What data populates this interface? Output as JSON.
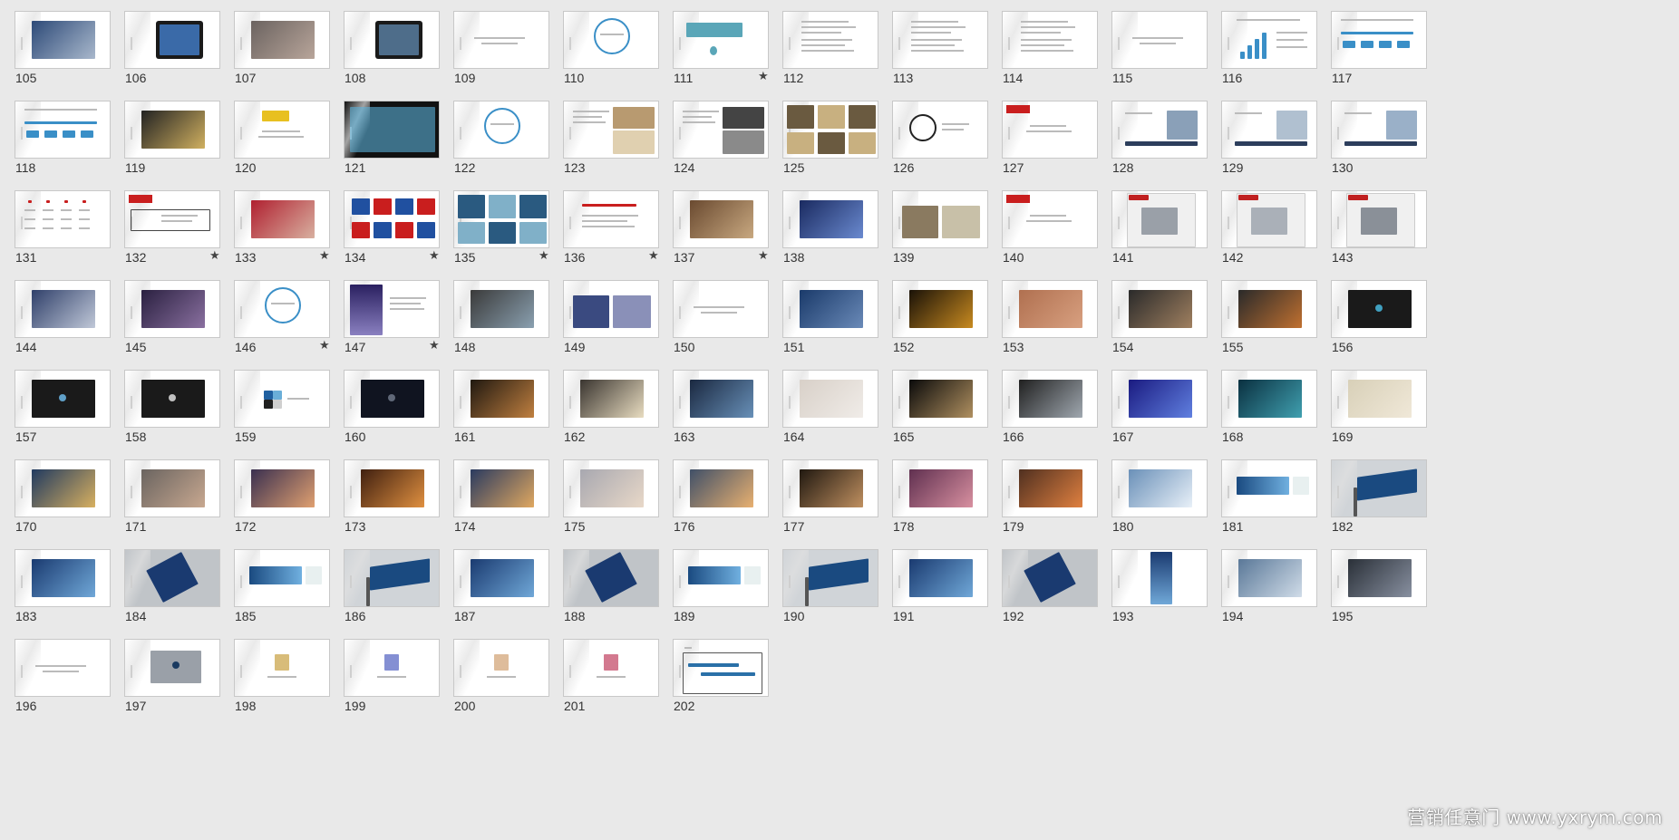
{
  "slides": [
    {
      "num": "105",
      "star": false,
      "v": "photo",
      "c": [
        "#2d4a78",
        "#a9b8cc"
      ]
    },
    {
      "num": "106",
      "star": false,
      "v": "tablet",
      "c": [
        "#1a1a1a",
        "#3a6aa8"
      ]
    },
    {
      "num": "107",
      "star": false,
      "v": "photo",
      "c": [
        "#6b6360",
        "#b8a59a"
      ]
    },
    {
      "num": "108",
      "star": false,
      "v": "tablet",
      "c": [
        "#1a1a1a",
        "#4e6d8a"
      ]
    },
    {
      "num": "109",
      "star": false,
      "v": "text",
      "c": [
        "#888888",
        "#ffffff"
      ]
    },
    {
      "num": "110",
      "star": false,
      "v": "circle",
      "c": [
        "#3a8fc7",
        "#ffffff"
      ]
    },
    {
      "num": "111",
      "star": true,
      "v": "banner",
      "c": [
        "#5aa6b8",
        "#ffffff"
      ]
    },
    {
      "num": "112",
      "star": false,
      "v": "doc",
      "c": [
        "#999999",
        "#ffffff"
      ]
    },
    {
      "num": "113",
      "star": false,
      "v": "doc",
      "c": [
        "#aaaaaa",
        "#ffffff"
      ]
    },
    {
      "num": "114",
      "star": false,
      "v": "doc",
      "c": [
        "#999999",
        "#ffffff"
      ]
    },
    {
      "num": "115",
      "star": false,
      "v": "text",
      "c": [
        "#aaaaaa",
        "#ffffff"
      ]
    },
    {
      "num": "116",
      "star": false,
      "v": "chart",
      "c": [
        "#3a8fc7",
        "#ffffff"
      ]
    },
    {
      "num": "117",
      "star": false,
      "v": "diagram",
      "c": [
        "#3a8fc7",
        "#ffffff"
      ]
    },
    {
      "num": "118",
      "star": false,
      "v": "diagram",
      "c": [
        "#3a8fc7",
        "#ffffff"
      ]
    },
    {
      "num": "119",
      "star": false,
      "v": "photo",
      "c": [
        "#222222",
        "#d0b060"
      ]
    },
    {
      "num": "120",
      "star": false,
      "v": "logo",
      "c": [
        "#e8c020",
        "#ffffff"
      ]
    },
    {
      "num": "121",
      "star": false,
      "v": "full",
      "c": [
        "#111111",
        "#5bb0d8"
      ]
    },
    {
      "num": "122",
      "star": false,
      "v": "circle",
      "c": [
        "#3a8fc7",
        "#ffffff"
      ]
    },
    {
      "num": "123",
      "star": false,
      "v": "photo-r",
      "c": [
        "#b89a70",
        "#e0d0b0"
      ]
    },
    {
      "num": "124",
      "star": false,
      "v": "photo-r",
      "c": [
        "#444444",
        "#8a8a8a"
      ]
    },
    {
      "num": "125",
      "star": false,
      "v": "collage",
      "c": [
        "#6a5a40",
        "#c8b080"
      ]
    },
    {
      "num": "126",
      "star": false,
      "v": "circle-b",
      "c": [
        "#222222",
        "#ffffff"
      ]
    },
    {
      "num": "127",
      "star": false,
      "v": "redtag",
      "c": [
        "#c91e1e",
        "#ffffff"
      ]
    },
    {
      "num": "128",
      "star": false,
      "v": "dark-bar",
      "c": [
        "#2c3e5c",
        "#8aa0b8"
      ]
    },
    {
      "num": "129",
      "star": false,
      "v": "dark-bar",
      "c": [
        "#2c3e5c",
        "#b0c0d0"
      ]
    },
    {
      "num": "130",
      "star": false,
      "v": "dark-bar",
      "c": [
        "#2c3e5c",
        "#9ab0c8"
      ]
    },
    {
      "num": "131",
      "star": false,
      "v": "table",
      "c": [
        "#c91e1e",
        "#ffffff"
      ]
    },
    {
      "num": "132",
      "star": true,
      "v": "redtag-box",
      "c": [
        "#c91e1e",
        "#ffffff"
      ]
    },
    {
      "num": "133",
      "star": true,
      "v": "photo",
      "c": [
        "#b02030",
        "#d8b0a0"
      ]
    },
    {
      "num": "134",
      "star": true,
      "v": "flags",
      "c": [
        "#c91e1e",
        "#2050a0"
      ]
    },
    {
      "num": "135",
      "star": true,
      "v": "collage",
      "c": [
        "#2a5a80",
        "#80b0c8"
      ]
    },
    {
      "num": "136",
      "star": true,
      "v": "text-red",
      "c": [
        "#c91e1e",
        "#ffffff"
      ]
    },
    {
      "num": "137",
      "star": true,
      "v": "photo",
      "c": [
        "#6a4a30",
        "#c8a880"
      ]
    },
    {
      "num": "138",
      "star": false,
      "v": "photo",
      "c": [
        "#1a2a60",
        "#6a8ad0"
      ]
    },
    {
      "num": "139",
      "star": false,
      "v": "photo-2",
      "c": [
        "#8a7a60",
        "#c8c0a8"
      ]
    },
    {
      "num": "140",
      "star": false,
      "v": "redtag",
      "c": [
        "#c91e1e",
        "#ffffff"
      ]
    },
    {
      "num": "141",
      "star": false,
      "v": "news",
      "c": [
        "#c02020",
        "#9aa0a8"
      ]
    },
    {
      "num": "142",
      "star": false,
      "v": "news",
      "c": [
        "#c02020",
        "#aab0b8"
      ]
    },
    {
      "num": "143",
      "star": false,
      "v": "news",
      "c": [
        "#c02020",
        "#8a9098"
      ]
    },
    {
      "num": "144",
      "star": false,
      "v": "photo",
      "c": [
        "#30406a",
        "#c0c8d8"
      ]
    },
    {
      "num": "145",
      "star": false,
      "v": "photo",
      "c": [
        "#2a2040",
        "#8a70a0"
      ]
    },
    {
      "num": "146",
      "star": true,
      "v": "circle",
      "c": [
        "#3a8fc7",
        "#ffffff"
      ]
    },
    {
      "num": "147",
      "star": true,
      "v": "photo-l",
      "c": [
        "#2a2060",
        "#8a80c0"
      ]
    },
    {
      "num": "148",
      "star": false,
      "v": "photo",
      "c": [
        "#3a3a3a",
        "#8aa0b0"
      ]
    },
    {
      "num": "149",
      "star": false,
      "v": "photo-2",
      "c": [
        "#3a4a80",
        "#8a90b8"
      ]
    },
    {
      "num": "150",
      "star": false,
      "v": "text",
      "c": [
        "#aaaaaa",
        "#ffffff"
      ]
    },
    {
      "num": "151",
      "star": false,
      "v": "photo",
      "c": [
        "#1a3a6a",
        "#6a8ab8"
      ]
    },
    {
      "num": "152",
      "star": false,
      "v": "photo",
      "c": [
        "#1a1208",
        "#c88a20"
      ]
    },
    {
      "num": "153",
      "star": false,
      "v": "photo",
      "c": [
        "#b07050",
        "#d8a080"
      ]
    },
    {
      "num": "154",
      "star": false,
      "v": "photo",
      "c": [
        "#2a2a2a",
        "#a08060"
      ]
    },
    {
      "num": "155",
      "star": false,
      "v": "photo",
      "c": [
        "#2a2a2a",
        "#c07030"
      ]
    },
    {
      "num": "156",
      "star": false,
      "v": "dark",
      "c": [
        "#1a1a1a",
        "#40a0c0"
      ]
    },
    {
      "num": "157",
      "star": false,
      "v": "dark",
      "c": [
        "#1a1a1a",
        "#60a0c8"
      ]
    },
    {
      "num": "158",
      "star": false,
      "v": "dark",
      "c": [
        "#1a1a1a",
        "#c0c0c0"
      ]
    },
    {
      "num": "159",
      "star": false,
      "v": "swatch",
      "c": [
        "#2060a0",
        "#202020"
      ]
    },
    {
      "num": "160",
      "star": false,
      "v": "dark",
      "c": [
        "#101420",
        "#606878"
      ]
    },
    {
      "num": "161",
      "star": false,
      "v": "photo",
      "c": [
        "#201810",
        "#c08040"
      ]
    },
    {
      "num": "162",
      "star": false,
      "v": "photo",
      "c": [
        "#3a3530",
        "#e8dcc0"
      ]
    },
    {
      "num": "163",
      "star": false,
      "v": "photo",
      "c": [
        "#1a2840",
        "#6890b8"
      ]
    },
    {
      "num": "164",
      "star": false,
      "v": "photo",
      "c": [
        "#d8d0c8",
        "#f0ece8"
      ]
    },
    {
      "num": "165",
      "star": false,
      "v": "photo",
      "c": [
        "#0a0a0a",
        "#b09060"
      ]
    },
    {
      "num": "166",
      "star": false,
      "v": "photo",
      "c": [
        "#202020",
        "#a0a8b0"
      ]
    },
    {
      "num": "167",
      "star": false,
      "v": "photo",
      "c": [
        "#1a1a80",
        "#6080e0"
      ]
    },
    {
      "num": "168",
      "star": false,
      "v": "photo",
      "c": [
        "#0a3040",
        "#40a0b0"
      ]
    },
    {
      "num": "169",
      "star": false,
      "v": "photo",
      "c": [
        "#d8d0b8",
        "#f0e8d8"
      ]
    },
    {
      "num": "170",
      "star": false,
      "v": "photo",
      "c": [
        "#203a60",
        "#d8b060"
      ]
    },
    {
      "num": "171",
      "star": false,
      "v": "photo",
      "c": [
        "#6a6460",
        "#c8a890"
      ]
    },
    {
      "num": "172",
      "star": false,
      "v": "photo",
      "c": [
        "#3a3050",
        "#e0a070"
      ]
    },
    {
      "num": "173",
      "star": false,
      "v": "photo",
      "c": [
        "#402010",
        "#e09040"
      ]
    },
    {
      "num": "174",
      "star": false,
      "v": "photo",
      "c": [
        "#2a3a60",
        "#e0a860"
      ]
    },
    {
      "num": "175",
      "star": false,
      "v": "photo",
      "c": [
        "#a8a8b0",
        "#e8d8c8"
      ]
    },
    {
      "num": "176",
      "star": false,
      "v": "photo",
      "c": [
        "#405068",
        "#e8b070"
      ]
    },
    {
      "num": "177",
      "star": false,
      "v": "photo",
      "c": [
        "#201810",
        "#c09060"
      ]
    },
    {
      "num": "178",
      "star": false,
      "v": "photo",
      "c": [
        "#603050",
        "#d890a0"
      ]
    },
    {
      "num": "179",
      "star": false,
      "v": "photo",
      "c": [
        "#503020",
        "#e08040"
      ]
    },
    {
      "num": "180",
      "star": false,
      "v": "photo",
      "c": [
        "#6a90b8",
        "#e8f0f8"
      ]
    },
    {
      "num": "181",
      "star": false,
      "v": "banner-w",
      "c": [
        "#1a4a80",
        "#70b0e0"
      ]
    },
    {
      "num": "182",
      "star": false,
      "v": "billboard",
      "c": [
        "#1a4a80",
        "#d0d4d8"
      ]
    },
    {
      "num": "183",
      "star": false,
      "v": "photo",
      "c": [
        "#1a3a70",
        "#70a8d8"
      ]
    },
    {
      "num": "184",
      "star": false,
      "v": "tilt",
      "c": [
        "#1a3a70",
        "#c0c4c8"
      ]
    },
    {
      "num": "185",
      "star": false,
      "v": "banner-w",
      "c": [
        "#1a4a80",
        "#70b0e0"
      ]
    },
    {
      "num": "186",
      "star": false,
      "v": "billboard",
      "c": [
        "#1a4a80",
        "#d0d4d8"
      ]
    },
    {
      "num": "187",
      "star": false,
      "v": "photo",
      "c": [
        "#1a3a70",
        "#70a8d8"
      ]
    },
    {
      "num": "188",
      "star": false,
      "v": "tilt",
      "c": [
        "#1a3a70",
        "#c0c4c8"
      ]
    },
    {
      "num": "189",
      "star": false,
      "v": "banner-w",
      "c": [
        "#1a4a80",
        "#70b0e0"
      ]
    },
    {
      "num": "190",
      "star": false,
      "v": "billboard",
      "c": [
        "#1a4a80",
        "#d0d4d8"
      ]
    },
    {
      "num": "191",
      "star": false,
      "v": "photo",
      "c": [
        "#1a3a70",
        "#70a8d8"
      ]
    },
    {
      "num": "192",
      "star": false,
      "v": "tilt",
      "c": [
        "#1a3a70",
        "#c0c4c8"
      ]
    },
    {
      "num": "193",
      "star": false,
      "v": "poster",
      "c": [
        "#1a3a70",
        "#70a8d8"
      ]
    },
    {
      "num": "194",
      "star": false,
      "v": "photo",
      "c": [
        "#5a7898",
        "#d0dce8"
      ]
    },
    {
      "num": "195",
      "star": false,
      "v": "photo",
      "c": [
        "#2a3038",
        "#8890a0"
      ]
    },
    {
      "num": "196",
      "star": false,
      "v": "text",
      "c": [
        "#aaaaaa",
        "#ffffff"
      ]
    },
    {
      "num": "197",
      "star": false,
      "v": "gray",
      "c": [
        "#9aa0a8",
        "#1a3a60"
      ]
    },
    {
      "num": "198",
      "star": false,
      "v": "logo-s",
      "c": [
        "#c8a040",
        "#ffffff"
      ]
    },
    {
      "num": "199",
      "star": false,
      "v": "logo-s",
      "c": [
        "#5060c0",
        "#ffffff"
      ]
    },
    {
      "num": "200",
      "star": false,
      "v": "logo-s",
      "c": [
        "#d0a070",
        "#ffffff"
      ]
    },
    {
      "num": "201",
      "star": false,
      "v": "logo-s",
      "c": [
        "#c04060",
        "#ffffff"
      ]
    },
    {
      "num": "202",
      "star": false,
      "v": "timeline",
      "c": [
        "#2a70a8",
        "#ffffff"
      ]
    }
  ],
  "watermark": "营销任意门 www.yxrym.com"
}
